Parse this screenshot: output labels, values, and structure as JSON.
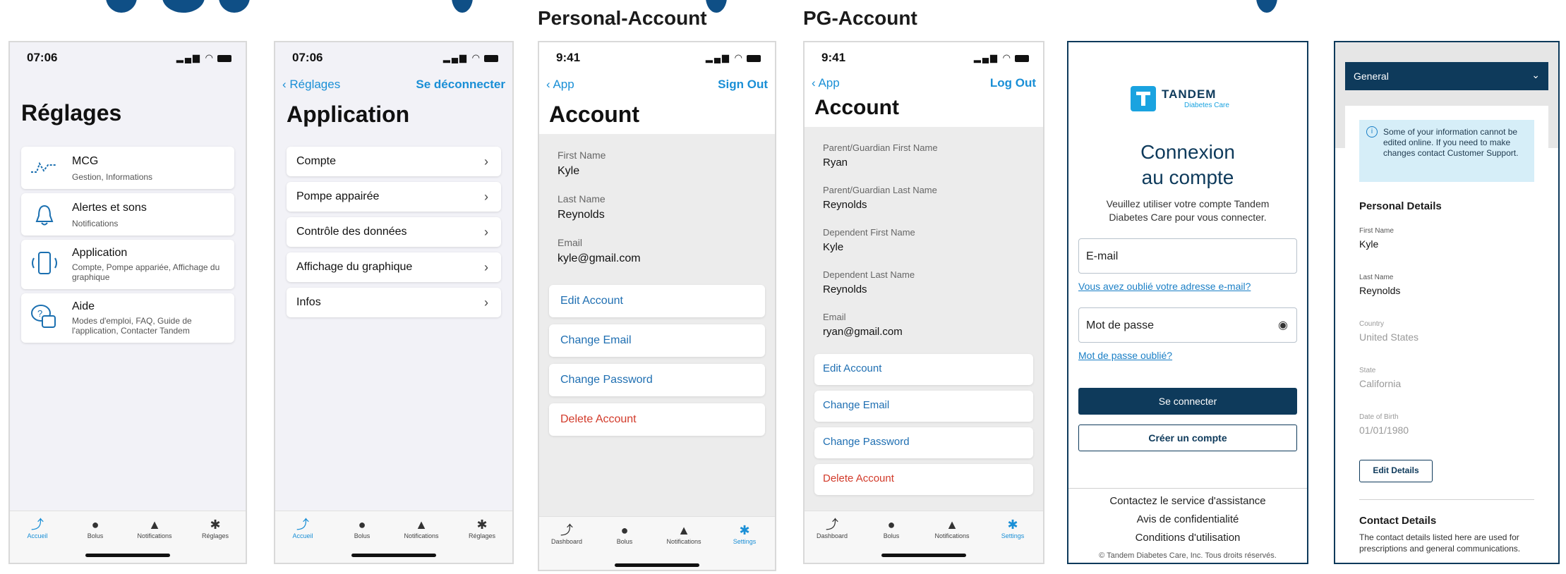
{
  "captions": {
    "personal": "Personal-Account",
    "pg": "PG-Account"
  },
  "colors": {
    "accent": "#1a8fd6",
    "danger": "#d23a2a",
    "navy": "#0e3a5b",
    "info_bg": "#d6eef8"
  },
  "screen1": {
    "time": "07:06",
    "title": "Réglages",
    "items": [
      {
        "icon": "cgm-icon",
        "title": "MCG",
        "sub": "Gestion, Informations"
      },
      {
        "icon": "bell-icon",
        "title": "Alertes et sons",
        "sub": "Notifications"
      },
      {
        "icon": "phone-icon",
        "title": "Application",
        "sub": "Compte, Pompe appariée, Affichage du graphique"
      },
      {
        "icon": "help-icon",
        "title": "Aide",
        "sub": "Modes d'emploi, FAQ, Guide de l'application, Contacter Tandem"
      }
    ],
    "tabs": [
      "Accueil",
      "Bolus",
      "Notifications",
      "Réglages"
    ]
  },
  "screen2": {
    "time": "07:06",
    "back": "Réglages",
    "right": "Se déconnecter",
    "title": "Application",
    "items": [
      "Compte",
      "Pompe appairée",
      "Contrôle des données",
      "Affichage du graphique",
      "Infos"
    ],
    "tabs": [
      "Accueil",
      "Bolus",
      "Notifications",
      "Réglages"
    ]
  },
  "screen3": {
    "time": "9:41",
    "back": "App",
    "right": "Sign Out",
    "title": "Account",
    "fields": [
      {
        "label": "First Name",
        "value": "Kyle"
      },
      {
        "label": "Last Name",
        "value": "Reynolds"
      },
      {
        "label": "Email",
        "value": "kyle@gmail.com"
      }
    ],
    "buttons": [
      "Edit Account",
      "Change Email",
      "Change Password",
      "Delete Account"
    ],
    "tabs": [
      "Dashboard",
      "Bolus",
      "Notifications",
      "Settings"
    ]
  },
  "screen4": {
    "time": "9:41",
    "back": "App",
    "right": "Log Out",
    "title": "Account",
    "fields": [
      {
        "label": "Parent/Guardian First Name",
        "value": "Ryan"
      },
      {
        "label": "Parent/Guardian Last Name",
        "value": "Reynolds"
      },
      {
        "label": "Dependent First Name",
        "value": "Kyle"
      },
      {
        "label": "Dependent Last Name",
        "value": "Reynolds"
      },
      {
        "label": "Email",
        "value": "ryan@gmail.com"
      }
    ],
    "buttons": [
      "Edit Account",
      "Change Email",
      "Change Password",
      "Delete Account"
    ],
    "tabs": [
      "Dashboard",
      "Bolus",
      "Notifications",
      "Settings"
    ]
  },
  "screen5": {
    "logo_line1": "TANDEM",
    "logo_line2": "Diabetes Care",
    "heading1": "Connexion",
    "heading2": "au compte",
    "sub": "Veuillez utiliser votre compte Tandem Diabetes Care pour vous connecter.",
    "email_placeholder": "E-mail",
    "forgot_email": "Vous avez oublié votre adresse e-mail?",
    "password_placeholder": "Mot de passe",
    "forgot_password": "Mot de passe oublié?",
    "login_button": "Se connecter",
    "create_button": "Créer un compte",
    "footer_links": [
      "Contactez le service d'assistance",
      "Avis de confidentialité",
      "Conditions d'utilisation"
    ],
    "copyright": "© Tandem Diabetes Care, Inc. Tous droits réservés."
  },
  "screen6": {
    "dropdown": "General",
    "info": "Some of your information cannot be edited online. If you need to make changes contact Customer Support.",
    "section1": "Personal Details",
    "fields": [
      {
        "label": "First Name",
        "value": "Kyle"
      },
      {
        "label": "Last Name",
        "value": "Reynolds"
      },
      {
        "label": "Country",
        "value": "United States"
      },
      {
        "label": "State",
        "value": "California"
      },
      {
        "label": "Date of Birth",
        "value": "01/01/1980"
      }
    ],
    "edit_button": "Edit Details",
    "section2": "Contact Details",
    "contact_text": "The contact details listed here are used for prescriptions and general communications."
  }
}
